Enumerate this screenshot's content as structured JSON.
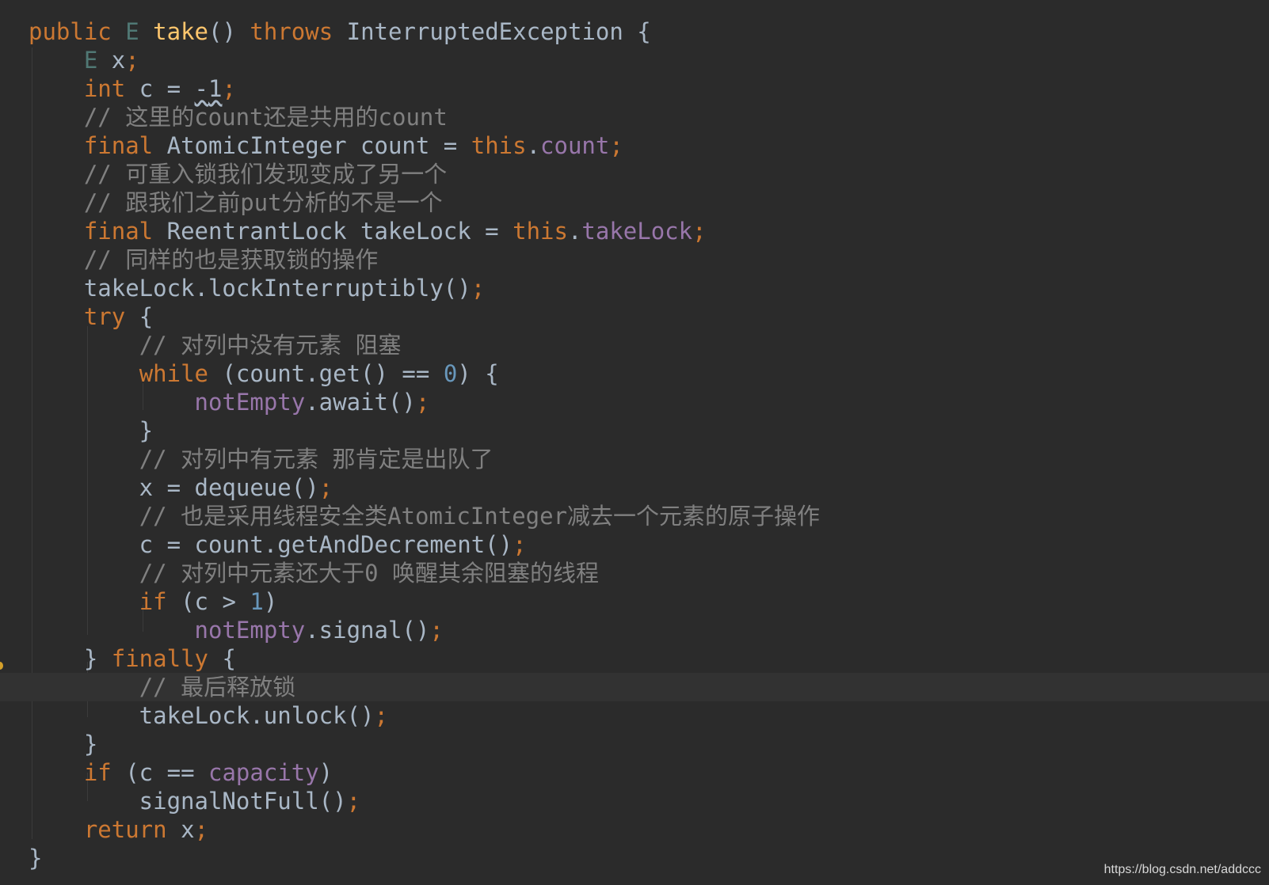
{
  "code_lines": [
    "public E take() throws InterruptedException {",
    "    E x;",
    "    int c = -1;",
    "    // 这里的count还是共用的count",
    "    final AtomicInteger count = this.count;",
    "    // 可重入锁我们发现变成了另一个",
    "    // 跟我们之前put分析的不是一个",
    "    final ReentrantLock takeLock = this.takeLock;",
    "    // 同样的也是获取锁的操作",
    "    takeLock.lockInterruptibly();",
    "    try {",
    "        // 对列中没有元素 阻塞",
    "        while (count.get() == 0) {",
    "            notEmpty.await();",
    "        }",
    "        // 对列中有元素 那肯定是出队了",
    "        x = dequeue();",
    "        // 也是采用线程安全类AtomicInteger减去一个元素的原子操作",
    "        c = count.getAndDecrement();",
    "        // 对列中元素还大于0 唤醒其余阻塞的线程",
    "        if (c > 1)",
    "            notEmpty.signal();",
    "    } finally {",
    "        // 最后释放锁",
    "        takeLock.unlock();",
    "    }",
    "    if (c == capacity)",
    "        signalNotFull();",
    "    return x;",
    "}"
  ],
  "watermark": "https://blog.csdn.net/addccc",
  "colors": {
    "background": "#2b2b2b",
    "current_line": "#323232",
    "keyword": "#cc7832",
    "method_declaration": "#ffc66d",
    "field": "#9876aa",
    "number": "#6897bb",
    "comment": "#808080",
    "text": "#a9b7c6"
  }
}
